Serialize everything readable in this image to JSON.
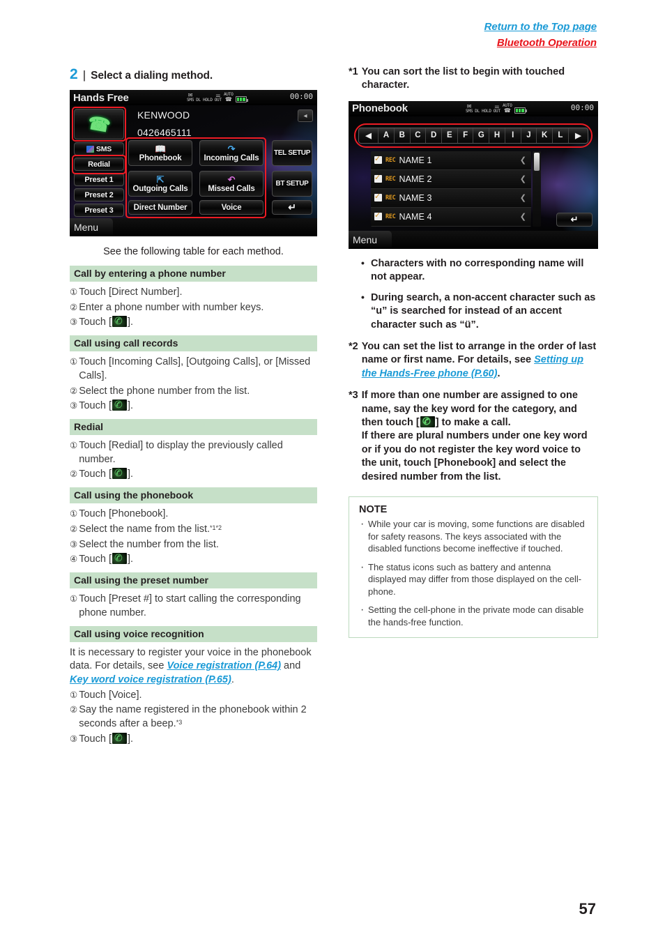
{
  "top_links": {
    "return_top": "Return to the Top page",
    "bluetooth_operation": "Bluetooth Operation"
  },
  "step": {
    "number": "2",
    "separator": "|",
    "title": "Select a dialing method."
  },
  "screen1": {
    "title": "Hands Free",
    "status": {
      "sms": "SMS",
      "dl": "DL",
      "hold": "HOLD",
      "out": "OUT",
      "auto": "AUTO",
      "clock": "00:00"
    },
    "device_name": "KENWOOD",
    "device_number": "0426465111",
    "side_keys": [
      "SMS",
      "Redial",
      "Preset 1",
      "Preset 2",
      "Preset 3"
    ],
    "grid_keys": [
      "Phonebook",
      "Incoming Calls",
      "Outgoing Calls",
      "Missed Calls",
      "Direct Number",
      "Voice"
    ],
    "right_keys": [
      "TEL SETUP",
      "BT SETUP"
    ],
    "menu": "Menu"
  },
  "screen2": {
    "title": "Phonebook",
    "status": {
      "sms": "SMS",
      "dl": "DL",
      "hold": "HOLD",
      "out": "OUT",
      "auto": "AUTO",
      "clock": "00:00"
    },
    "alpha_keys": [
      "◀",
      "A",
      "B",
      "C",
      "D",
      "E",
      "F",
      "G",
      "H",
      "I",
      "J",
      "K",
      "L",
      "▶"
    ],
    "rows": [
      {
        "tag": "REC",
        "name": "NAME 1"
      },
      {
        "tag": "REC",
        "name": "NAME 2"
      },
      {
        "tag": "REC",
        "name": "NAME 3"
      },
      {
        "tag": "REC",
        "name": "NAME 4"
      }
    ],
    "menu": "Menu"
  },
  "caption": "See the following table for each method.",
  "sections": [
    {
      "heading": "Call by entering a phone number",
      "items": [
        {
          "num": "①",
          "text": "Touch [Direct Number]."
        },
        {
          "num": "②",
          "text": "Enter a phone number with number keys."
        },
        {
          "num": "③",
          "text": "Touch [",
          "icon": "phone-icon",
          "after": "]."
        }
      ]
    },
    {
      "heading": "Call using call records",
      "items": [
        {
          "num": "①",
          "text": "Touch [Incoming Calls], [Outgoing Calls], or [Missed Calls]."
        },
        {
          "num": "②",
          "text": "Select the phone number from the list."
        },
        {
          "num": "③",
          "text": "Touch [",
          "icon": "phone-icon",
          "after": "]."
        }
      ]
    },
    {
      "heading": "Redial",
      "items": [
        {
          "num": "①",
          "text": "Touch [Redial] to display the previously called number."
        },
        {
          "num": "②",
          "text": "Touch [",
          "icon": "phone-icon",
          "after": "]."
        }
      ]
    },
    {
      "heading": "Call using the phonebook",
      "items": [
        {
          "num": "①",
          "text": "Touch [Phonebook]."
        },
        {
          "num": "②",
          "text": "Select the name from the list.",
          "sup": "*1*2"
        },
        {
          "num": "③",
          "text": "Select the number from the list."
        },
        {
          "num": "④",
          "text": "Touch [",
          "icon": "phone-icon",
          "after": "]."
        }
      ]
    },
    {
      "heading": "Call using the preset number",
      "items": [
        {
          "num": "①",
          "text": "Touch [Preset #] to start calling the corresponding phone number."
        }
      ]
    },
    {
      "heading": "Call using voice recognition",
      "intro_1": "It is necessary to register your voice in the phonebook data. For details, see ",
      "intro_link_1": "Voice registration (P.64)",
      "intro_2": " and ",
      "intro_link_2": "Key word voice registration (P.65)",
      "intro_3": ".",
      "items": [
        {
          "num": "①",
          "text": "Touch [Voice]."
        },
        {
          "num": "②",
          "text": "Say the name registered in the phonebook within 2 seconds after a beep.",
          "sup": "*3"
        },
        {
          "num": "③",
          "text": "Touch [",
          "icon": "phone-icon",
          "after": "]."
        }
      ]
    }
  ],
  "footnotes": {
    "fn1": {
      "marker": "*1",
      "text": "You can sort the list to begin with touched character."
    },
    "bullets": [
      "Characters with no corresponding name will not appear.",
      "During search, a non-accent character such as “u” is searched for instead of an accent character such as “ü”."
    ],
    "fn2": {
      "marker": "*2",
      "text_1": "You can set the list to arrange in the order of last name or first name. For details, see ",
      "link": "Setting up the Hands-Free phone (P.60)",
      "text_2": "."
    },
    "fn3": {
      "marker": "*3",
      "text_1": "If more than one number are assigned to one name, say the key word for the category, and then touch [",
      "text_2": "] to make a call.",
      "text_3": "If there are plural numbers under one key word or if you do not register the key word voice to the unit, touch [Phonebook] and select the desired number from the list."
    }
  },
  "note": {
    "title": "NOTE",
    "items": [
      "While your car is moving, some functions are disabled for safety reasons. The keys associated with the disabled functions become ineffective if touched.",
      "The status icons such as battery and antenna displayed may differ from those displayed on the cell-phone.",
      "Setting the cell-phone in the private mode can disable the hands-free function."
    ]
  },
  "page_number": "57",
  "colors": {
    "link_blue": "#1a9ad6",
    "link_red": "#e8131a",
    "section_green": "#c6e0c8",
    "note_border": "#bcd9bd"
  }
}
